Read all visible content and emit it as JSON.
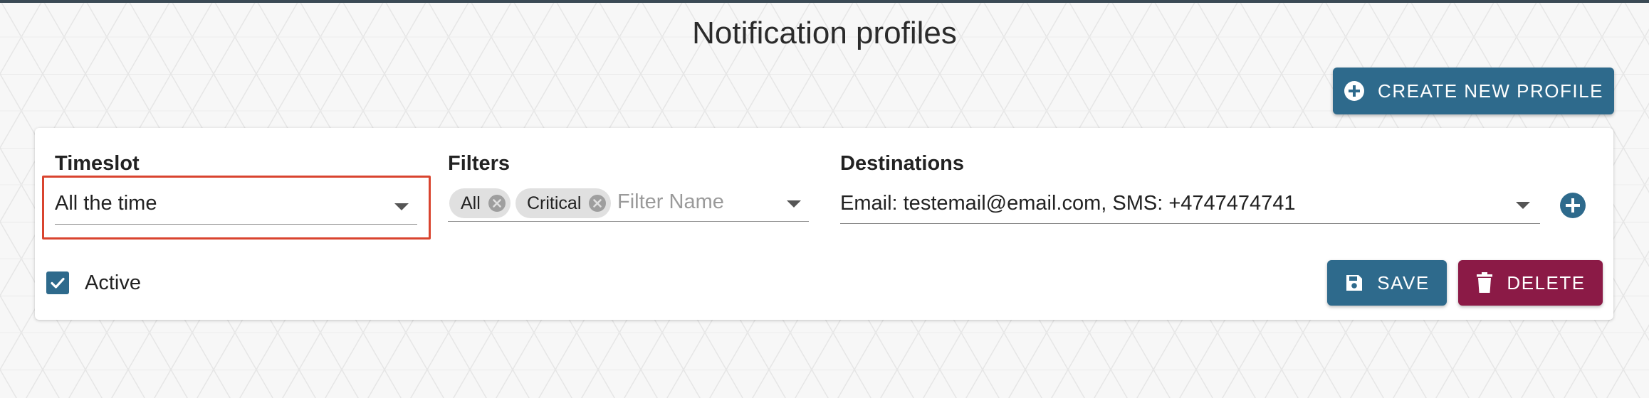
{
  "page": {
    "title": "Notification profiles"
  },
  "header": {
    "create_button_label": "CREATE NEW PROFILE",
    "create_icon": "add-circle-icon"
  },
  "profile": {
    "timeslot": {
      "label": "Timeslot",
      "value": "All the time"
    },
    "filters": {
      "label": "Filters",
      "chips": [
        "All",
        "Critical"
      ],
      "placeholder": "Filter Name"
    },
    "destinations": {
      "label": "Destinations",
      "value": "Email: testemail@email.com, SMS: +4747474741"
    },
    "active": {
      "label": "Active",
      "checked": true
    },
    "save_label": "SAVE",
    "delete_label": "DELETE"
  },
  "colors": {
    "primary": "#2e6a8c",
    "danger": "#8b1a46",
    "highlight": "#d9442f"
  }
}
